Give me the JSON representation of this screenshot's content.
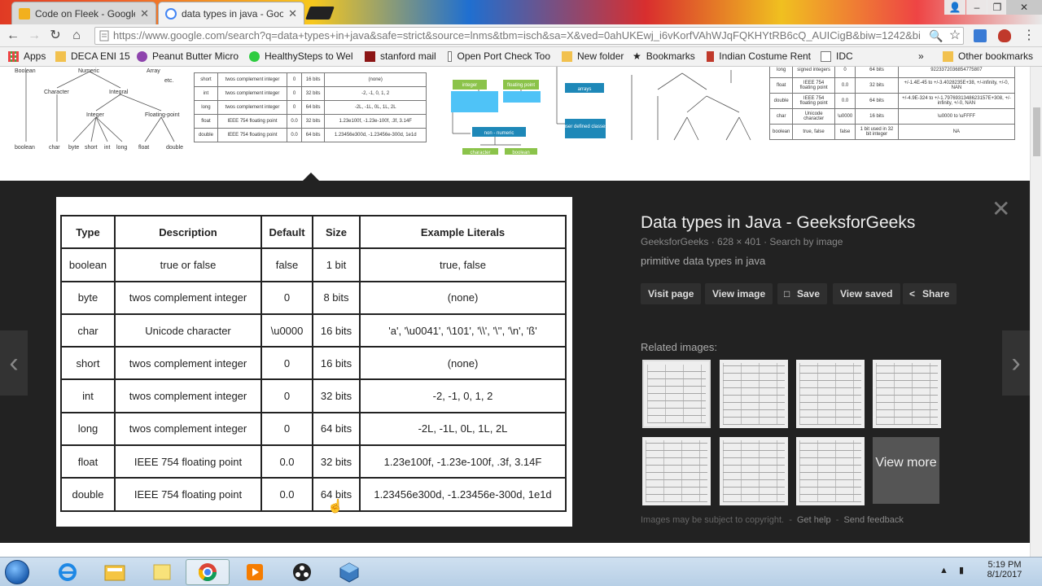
{
  "browser": {
    "tabs": [
      {
        "title": "Code on Fleek - Google",
        "active": false
      },
      {
        "title": "data types in java - Goog",
        "active": true
      }
    ],
    "url": "https://www.google.com/search?q=data+types+in+java&safe=strict&source=lnms&tbm=isch&sa=X&ved=0ahUKEwj_i6vKorfVAhWJqFQKHYtRB6cQ_AUICigB&biw=1242&bi",
    "bookmarks": [
      "Apps",
      "DECA ENI 15",
      "Peanut Butter Micro",
      "HealthySteps to Wel",
      "stanford mail",
      "Open Port Check Too",
      "New folder",
      "Bookmarks",
      "Indian Costume Rent",
      "IDC",
      "»",
      "Other bookmarks"
    ]
  },
  "thumbnails": {
    "tree": {
      "root_labels": [
        "Boolean",
        "Numeric",
        "Array",
        "etc."
      ],
      "mid_labels": [
        "Character",
        "Integral"
      ],
      "low_labels": [
        "Integer",
        "Floating-point"
      ],
      "leaf_labels": [
        "boolean",
        "char",
        "byte",
        "short",
        "int",
        "long",
        "float",
        "double"
      ]
    },
    "table_rows": [
      [
        "short",
        "twos complement integer",
        "0",
        "16 bits",
        "(none)"
      ],
      [
        "int",
        "twos complement integer",
        "0",
        "32 bits",
        "-2, -1, 0, 1, 2"
      ],
      [
        "long",
        "twos complement integer",
        "0",
        "64 bits",
        "-2L, -1L, 0L, 1L, 2L"
      ],
      [
        "float",
        "IEEE 754 floating point",
        "0.0",
        "32 bits",
        "1.23e100f, -1.23e-100f, .3f, 3.14F"
      ],
      [
        "double",
        "IEEE 754 floating point",
        "0.0",
        "64 bits",
        "1.23456e300d, -1.23456e-300d, 1e1d"
      ]
    ],
    "diagram_labels": [
      "integer",
      "floating point",
      "arrays",
      "non - numeric",
      "user defined classes",
      "character",
      "boolean"
    ],
    "right_rows": [
      [
        "long",
        "signed integers",
        "0",
        "64 bits",
        "9223372036854775807"
      ],
      [
        "float",
        "IEEE 754 floating point",
        "0.0",
        "32 bits",
        "+/-1.4E-45 to +/-3.4028235E+38, +/-infinity, +/-0, NAN"
      ],
      [
        "double",
        "IEEE 754 floating point",
        "0.0",
        "64 bits",
        "+/-4.9E-324 to +/-1.7976931348623157E+308, +/-infinity, +/-0, NAN"
      ],
      [
        "char",
        "Unicode character",
        "\\u0000",
        "16 bits",
        "\\u0000 to \\uFFFF"
      ],
      [
        "boolean",
        "true, false",
        "false",
        "1 bit used in 32 bit integer",
        "NA"
      ]
    ]
  },
  "preview": {
    "headers": [
      "Type",
      "Description",
      "Default",
      "Size",
      "Example Literals"
    ],
    "rows": [
      [
        "boolean",
        "true or false",
        "false",
        "1 bit",
        "true, false"
      ],
      [
        "byte",
        "twos complement integer",
        "0",
        "8 bits",
        "(none)"
      ],
      [
        "char",
        "Unicode character",
        "\\u0000",
        "16 bits",
        "'a', '\\u0041', '\\101', '\\\\', '\\'', '\\n', 'ß'"
      ],
      [
        "short",
        "twos complement integer",
        "0",
        "16 bits",
        "(none)"
      ],
      [
        "int",
        "twos complement integer",
        "0",
        "32 bits",
        "-2, -1, 0, 1, 2"
      ],
      [
        "long",
        "twos complement integer",
        "0",
        "64 bits",
        "-2L, -1L, 0L, 1L, 2L"
      ],
      [
        "float",
        "IEEE 754 floating point",
        "0.0",
        "32 bits",
        "1.23e100f, -1.23e-100f, .3f, 3.14F"
      ],
      [
        "double",
        "IEEE 754 floating point",
        "0.0",
        "64 bits",
        "1.23456e300d, -1.23456e-300d, 1e1d"
      ]
    ]
  },
  "info": {
    "title": "Data types in Java - GeeksforGeeks",
    "meta": "GeeksforGeeks · 628 × 401 · Search by image",
    "description": "primitive data types in java",
    "buttons": [
      "Visit page",
      "View image",
      "Save",
      "View saved",
      "Share"
    ],
    "related_label": "Related images:",
    "view_more": "View more",
    "footer": {
      "note": "Images may be subject to copyright.",
      "help": "Get help",
      "feedback": "Send feedback"
    }
  },
  "taskbar": {
    "time": "5:19 PM",
    "date": "8/1/2017"
  }
}
